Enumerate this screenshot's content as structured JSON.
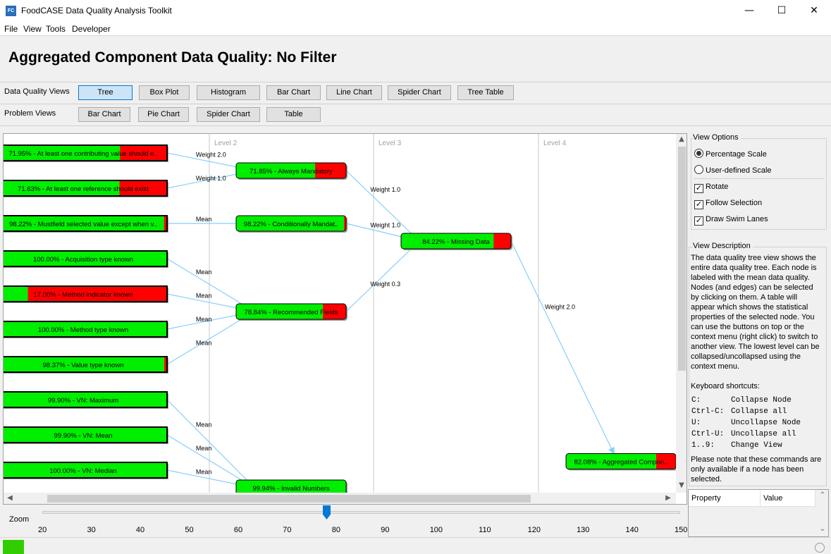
{
  "window": {
    "icon_text": "FC",
    "title": "FoodCASE Data Quality Analysis Toolkit",
    "minimize_glyph": "—",
    "maximize_glyph": "☐",
    "close_glyph": "✕"
  },
  "menu": [
    "File",
    "View",
    "Tools",
    "Developer"
  ],
  "page_title": "Aggregated Component Data Quality: No Filter",
  "dq_views": {
    "label": "Data Quality Views",
    "buttons": [
      "Tree",
      "Box Plot",
      "Histogram",
      "Bar Chart",
      "Line Chart",
      "Spider Chart",
      "Tree Table"
    ],
    "active": "Tree"
  },
  "problem_views": {
    "label": "Problem Views",
    "buttons": [
      "Bar Chart",
      "Pie Chart",
      "Spider Chart",
      "Table"
    ]
  },
  "tree": {
    "levels": [
      "Level 2",
      "Level 3",
      "Level 4"
    ],
    "colors": {
      "good": "#00ee00",
      "bad": "#ff0000",
      "edge": "#87cefa",
      "lane": "#c8c8c8"
    },
    "nodes": [
      {
        "id": "n1",
        "col": 1,
        "row": 0,
        "pct": 71.95,
        "label": "71.95% - At least one contributing value should e.."
      },
      {
        "id": "n2",
        "col": 1,
        "row": 1,
        "pct": 71.63,
        "label": "71.63% - At least one reference should exist"
      },
      {
        "id": "n3",
        "col": 1,
        "row": 2,
        "pct": 98.22,
        "label": "98.22% - Mustfield selected value except when v.."
      },
      {
        "id": "n4",
        "col": 1,
        "row": 3,
        "pct": 100.0,
        "label": "100.00% - Acquisition type known"
      },
      {
        "id": "n5",
        "col": 1,
        "row": 4,
        "pct": 17.0,
        "label": "17.00% - Method indicator known"
      },
      {
        "id": "n6",
        "col": 1,
        "row": 5,
        "pct": 100.0,
        "label": "100.00% - Method type known"
      },
      {
        "id": "n7",
        "col": 1,
        "row": 6,
        "pct": 98.37,
        "label": "98.37% - Value type known"
      },
      {
        "id": "n8",
        "col": 1,
        "row": 7,
        "pct": 99.9,
        "label": "99.90% - VN: Maximum"
      },
      {
        "id": "n9",
        "col": 1,
        "row": 8,
        "pct": 99.9,
        "label": "99.90% - VN: Mean"
      },
      {
        "id": "n10",
        "col": 1,
        "row": 9,
        "pct": 100.0,
        "label": "100.00% - VN: Median"
      },
      {
        "id": "m1",
        "col": 2,
        "row": 0.5,
        "pct": 71.85,
        "label": "71.85% - Always Mandatory"
      },
      {
        "id": "m2",
        "col": 2,
        "row": 2,
        "pct": 98.22,
        "label": "98.22% - Conditionally Mandat.."
      },
      {
        "id": "m3",
        "col": 2,
        "row": 4.5,
        "pct": 78.84,
        "label": "78.84% - Recommended Fields"
      },
      {
        "id": "m4",
        "col": 2,
        "row": 9.5,
        "pct": 99.94,
        "label": "99.94% - Invalid Numbers"
      },
      {
        "id": "d1",
        "col": 3,
        "row": 2.5,
        "pct": 84.22,
        "label": "84.22% - Missing Data"
      },
      {
        "id": "r1",
        "col": 4,
        "row": 8.75,
        "pct": 82.08,
        "label": "82.08% - Aggregated Compon.."
      }
    ],
    "edges": [
      {
        "from": "n1",
        "to": "m1",
        "label": "Weight 2.0"
      },
      {
        "from": "n2",
        "to": "m1",
        "label": "Weight 1.0"
      },
      {
        "from": "n3",
        "to": "m2",
        "label": "Mean"
      },
      {
        "from": "n4",
        "to": "m3",
        "label": "Mean"
      },
      {
        "from": "n5",
        "to": "m3",
        "label": "Mean"
      },
      {
        "from": "n6",
        "to": "m3",
        "label": "Mean"
      },
      {
        "from": "n7",
        "to": "m3",
        "label": "Mean"
      },
      {
        "from": "n8",
        "to": "m4",
        "label": "Mean"
      },
      {
        "from": "n9",
        "to": "m4",
        "label": "Mean"
      },
      {
        "from": "n10",
        "to": "m4",
        "label": "Mean"
      },
      {
        "from": "m1",
        "to": "d1",
        "label": "Weight 1.0"
      },
      {
        "from": "m2",
        "to": "d1",
        "label": "Weight 1.0"
      },
      {
        "from": "m3",
        "to": "d1",
        "label": "Weight 0.3"
      },
      {
        "from": "d1",
        "to": "r1",
        "label": "Weight 2.0"
      }
    ]
  },
  "zoom": {
    "label": "Zoom",
    "ticks": [
      "20",
      "30",
      "40",
      "50",
      "60",
      "70",
      "80",
      "90",
      "100",
      "110",
      "120",
      "130",
      "140",
      "150"
    ],
    "value": 78,
    "min": 20,
    "max": 150
  },
  "view_options": {
    "title": "View Options",
    "percentage_scale": "Percentage Scale",
    "user_defined_scale": "User-defined Scale",
    "selected_scale": "percentage",
    "rotate": "Rotate",
    "follow_selection": "Follow Selection",
    "draw_swim_lanes": "Draw Swim Lanes",
    "rotate_checked": true,
    "follow_checked": true,
    "swim_lanes_checked": true
  },
  "view_description": {
    "title": "View Description",
    "text": "The data quality tree view shows the entire data quality tree. Each node is labeled with the mean data quality. Nodes (and edges) can be selected by clicking on them. A table will appear which shows the statistical properties of the selected node. You can use the buttons on top or the context menu (right click) to switch to another view. The lowest level can be collapsed/uncollapsed using the context menu.",
    "shortcuts_title": "Keyboard shortcuts:",
    "shortcuts": [
      {
        "key": "C:",
        "action": "Collapse Node"
      },
      {
        "key": "Ctrl-C:",
        "action": "Collapse all"
      },
      {
        "key": "U:",
        "action": "Uncollapse Node"
      },
      {
        "key": "Ctrl-U:",
        "action": "Uncollapse all"
      },
      {
        "key": "1..9:",
        "action": "Change View"
      }
    ],
    "note": "Please note that these commands are only available if a node has been selected."
  },
  "property_table": {
    "headers": [
      "Property",
      "Value"
    ]
  }
}
